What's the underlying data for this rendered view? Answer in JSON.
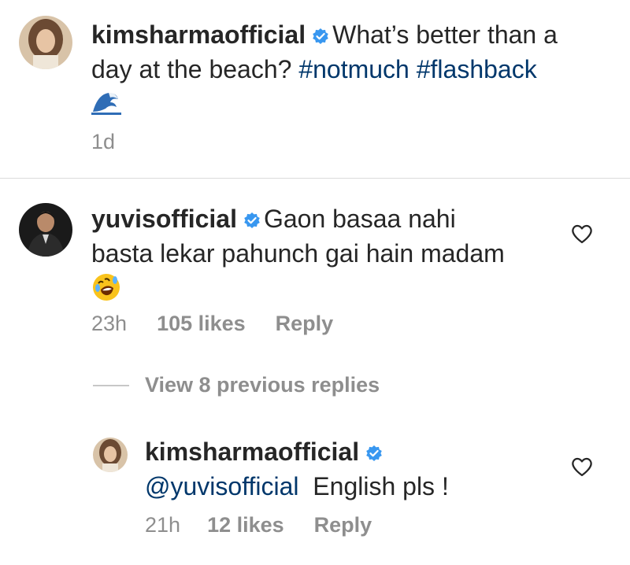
{
  "caption": {
    "username": "kimsharmaofficial",
    "text": "What’s better than a",
    "text_line2": "day at the beach?",
    "hashtags": [
      "#notmuch",
      "#flashback"
    ],
    "emoji_icon": "wave-emoji-icon",
    "time": "1d"
  },
  "comment": {
    "username": "yuvisofficial",
    "text_line1": "Gaon basaa nahi",
    "text_line2": "basta lekar pahunch gai hain madam",
    "emoji_icon": "rofl-emoji-icon",
    "time": "23h",
    "likes": "105 likes",
    "reply": "Reply"
  },
  "view_replies": "View 8 previous replies",
  "reply": {
    "username": "kimsharmaofficial",
    "mention": "@yuvisofficial",
    "text": "English pls !",
    "time": "21h",
    "likes": "12 likes",
    "reply": "Reply"
  },
  "colors": {
    "text": "#262626",
    "muted": "#8e8e8e",
    "link": "#00376b",
    "verified": "#3897f0"
  }
}
